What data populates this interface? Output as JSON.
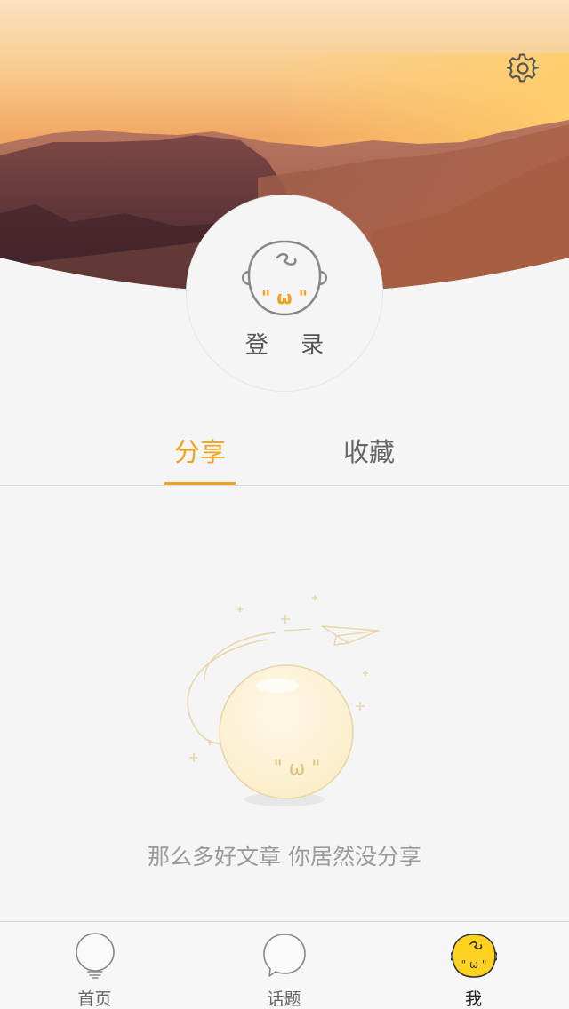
{
  "header": {
    "settings_icon": "gear-icon"
  },
  "profile": {
    "avatar_icon": "baby-face-icon",
    "avatar_face_text": "\" ω \"",
    "login_label": "登 录"
  },
  "tabs": [
    {
      "label": "分享",
      "active": true
    },
    {
      "label": "收藏",
      "active": false
    }
  ],
  "empty_state": {
    "illustration_face_text": "\" ω \"",
    "message": "那么多好文章 你居然没分享"
  },
  "tabbar": {
    "items": [
      {
        "label": "首页",
        "icon": "lightbulb-icon",
        "active": false
      },
      {
        "label": "话题",
        "icon": "speech-bubble-icon",
        "active": false
      },
      {
        "label": "我",
        "icon": "face-icon",
        "active": true
      }
    ]
  },
  "colors": {
    "accent": "#f0a31c",
    "tabbar_active_fill": "#ffd21f"
  }
}
